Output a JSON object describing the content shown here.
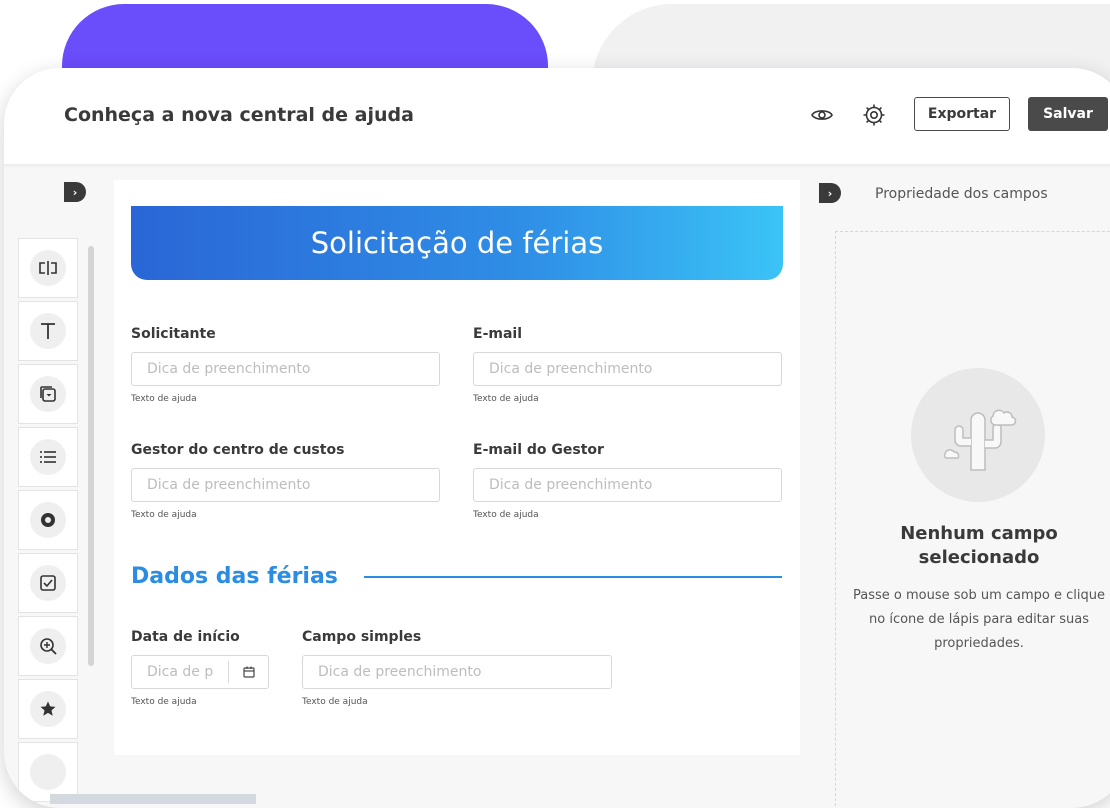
{
  "header": {
    "title": "Conheça a nova central de ajuda",
    "export_label": "Exportar",
    "save_label": "Salvar",
    "icons": [
      "eye-icon",
      "gear-icon"
    ]
  },
  "toolbox": {
    "items": [
      {
        "icon": "text-field-icon"
      },
      {
        "icon": "text-icon"
      },
      {
        "icon": "dropdown-icon"
      },
      {
        "icon": "list-icon"
      },
      {
        "icon": "radio-icon"
      },
      {
        "icon": "checkbox-icon"
      },
      {
        "icon": "zoom-in-icon"
      },
      {
        "icon": "star-icon"
      }
    ]
  },
  "form": {
    "title": "Solicitação de férias",
    "fields": {
      "solicitante": {
        "label": "Solicitante",
        "placeholder": "Dica de preenchimento",
        "help": "Texto de ajuda"
      },
      "email": {
        "label": "E-mail",
        "placeholder": "Dica de preenchimento",
        "help": "Texto de ajuda"
      },
      "gestor": {
        "label": "Gestor do centro de custos",
        "placeholder": "Dica de preenchimento",
        "help": "Texto de ajuda"
      },
      "email_gestor": {
        "label": "E-mail do Gestor",
        "placeholder": "Dica de preenchimento",
        "help": "Texto de ajuda"
      },
      "data_inicio": {
        "label": "Data de início",
        "placeholder": "Dica de p",
        "help": "Texto de ajuda"
      },
      "campo_simples": {
        "label": "Campo simples",
        "placeholder": "Dica de preenchimento",
        "help": "Texto de ajuda"
      }
    },
    "section_title": "Dados das férias"
  },
  "properties": {
    "title": "Propriedade dos campos",
    "empty_title": "Nenhum campo selecionado",
    "empty_desc": "Passe o mouse sob um campo e clique no ícone de lápis para editar suas propriedades."
  },
  "colors": {
    "accent_purple": "#6a4dfb",
    "primary_blue": "#2a8de3",
    "dark_button": "#4a4a4a"
  }
}
